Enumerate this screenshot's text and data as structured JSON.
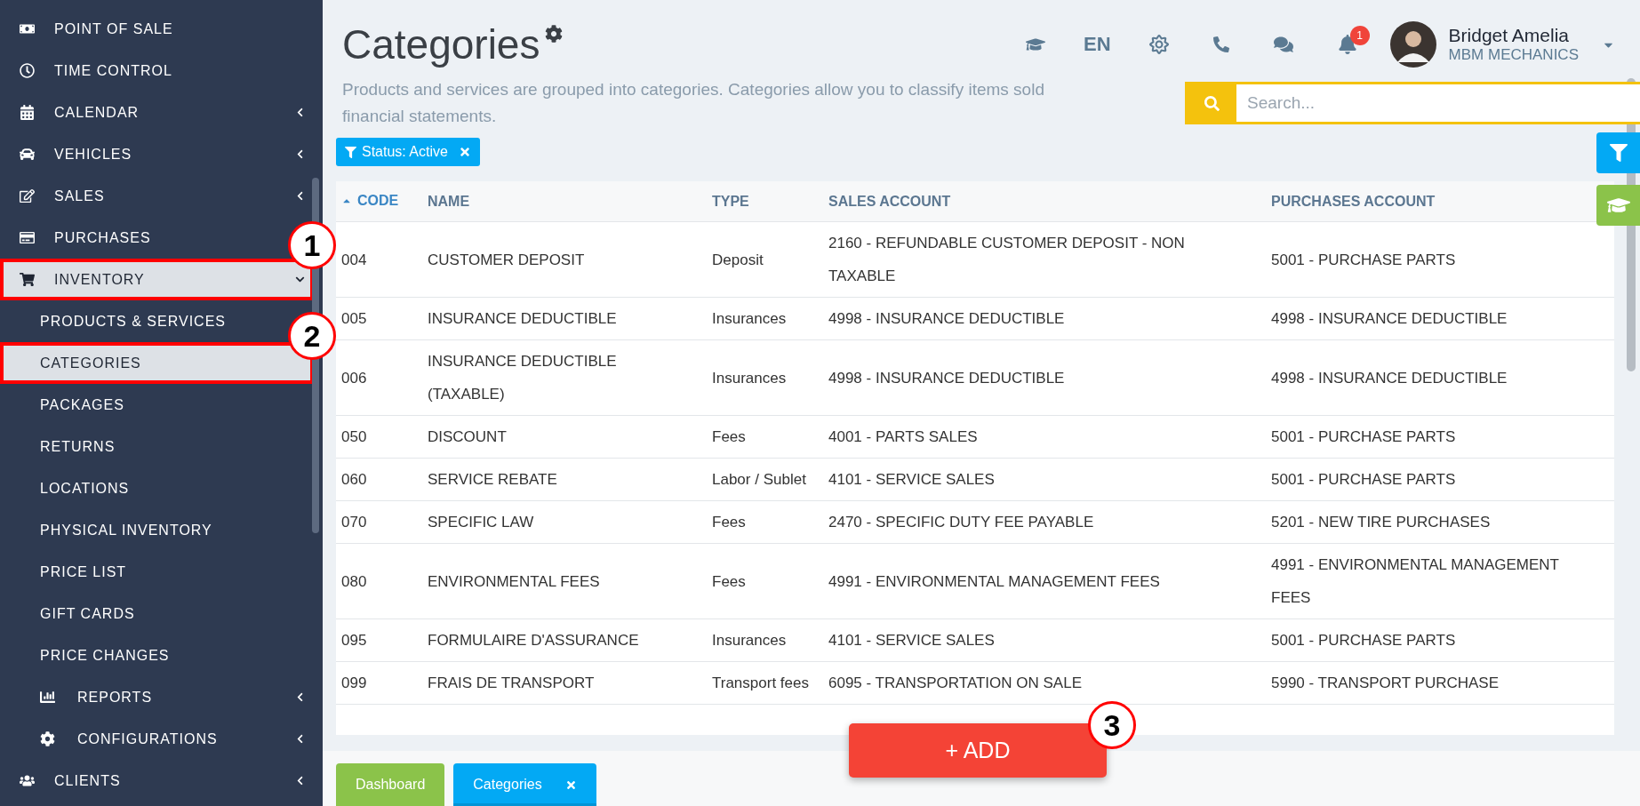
{
  "sidebar": {
    "items": [
      {
        "label": "POINT OF SALE",
        "kind": "link",
        "selected": false
      },
      {
        "label": "TIME CONTROL",
        "kind": "link",
        "selected": false
      },
      {
        "label": "CALENDAR",
        "kind": "group",
        "expanded": false,
        "selected": false
      },
      {
        "label": "VEHICLES",
        "kind": "group",
        "expanded": false,
        "selected": false
      },
      {
        "label": "SALES",
        "kind": "group",
        "expanded": false,
        "selected": false
      },
      {
        "label": "PURCHASES",
        "kind": "link",
        "selected": false
      },
      {
        "label": "INVENTORY",
        "kind": "group",
        "expanded": true,
        "selected": true,
        "annotation": "1",
        "children": [
          {
            "label": "PRODUCTS & SERVICES",
            "kind": "link",
            "selected": false
          },
          {
            "label": "CATEGORIES",
            "kind": "link",
            "selected": true,
            "annotation": "2"
          },
          {
            "label": "PACKAGES",
            "kind": "link",
            "selected": false
          },
          {
            "label": "RETURNS",
            "kind": "link",
            "selected": false
          },
          {
            "label": "LOCATIONS",
            "kind": "link",
            "selected": false
          },
          {
            "label": "PHYSICAL INVENTORY",
            "kind": "link",
            "selected": false
          },
          {
            "label": "PRICE LIST",
            "kind": "link",
            "selected": false
          },
          {
            "label": "GIFT CARDS",
            "kind": "link",
            "selected": false
          },
          {
            "label": "PRICE CHANGES",
            "kind": "link",
            "selected": false
          },
          {
            "label": "REPORTS",
            "kind": "group",
            "expanded": false,
            "selected": false
          },
          {
            "label": "CONFIGURATIONS",
            "kind": "group",
            "expanded": false,
            "selected": false
          }
        ]
      },
      {
        "label": "CLIENTS",
        "kind": "group",
        "expanded": false,
        "selected": false
      }
    ]
  },
  "header": {
    "title": "Categories",
    "description_lines": [
      "Products and services are grouped into categories. Categories allow you to classify items sold",
      "financial statements."
    ],
    "language": "EN",
    "notifications": "1",
    "user": {
      "name": "Bridget Amelia",
      "company": "MBM MECHANICS"
    }
  },
  "search": {
    "placeholder": "Search..."
  },
  "filters": [
    {
      "label": "Status: Active"
    }
  ],
  "table": {
    "columns": [
      {
        "label": "CODE",
        "sorted": true
      },
      {
        "label": "NAME",
        "sorted": false
      },
      {
        "label": "TYPE",
        "sorted": false
      },
      {
        "label": "SALES ACCOUNT",
        "sorted": false
      },
      {
        "label": "PURCHASES ACCOUNT",
        "sorted": false
      }
    ],
    "rows": [
      [
        "004",
        "CUSTOMER DEPOSIT",
        "Deposit",
        "2160 - REFUNDABLE CUSTOMER DEPOSIT - NON TAXABLE",
        "5001 - PURCHASE PARTS"
      ],
      [
        "005",
        "INSURANCE DEDUCTIBLE",
        "Insurances",
        "4998 - INSURANCE DEDUCTIBLE",
        "4998 - INSURANCE DEDUCTIBLE"
      ],
      [
        "006",
        "INSURANCE DEDUCTIBLE (TAXABLE)",
        "Insurances",
        "4998 - INSURANCE DEDUCTIBLE",
        "4998 - INSURANCE DEDUCTIBLE"
      ],
      [
        "050",
        "DISCOUNT",
        "Fees",
        "4001 - PARTS SALES",
        "5001 - PURCHASE PARTS"
      ],
      [
        "060",
        "SERVICE REBATE",
        "Labor / Sublet",
        "4101 - SERVICE SALES",
        "5001 - PURCHASE PARTS"
      ],
      [
        "070",
        "SPECIFIC LAW",
        "Fees",
        "2470 - SPECIFIC DUTY FEE PAYABLE",
        "5201 - NEW TIRE PURCHASES"
      ],
      [
        "080",
        "ENVIRONMENTAL FEES",
        "Fees",
        "4991 - ENVIRONMENTAL MANAGEMENT FEES",
        "4991 - ENVIRONMENTAL MANAGEMENT FEES"
      ],
      [
        "095",
        "FORMULAIRE D'ASSURANCE",
        "Insurances",
        "4101 - SERVICE SALES",
        "5001 - PURCHASE PARTS"
      ],
      [
        "099",
        "FRAIS DE TRANSPORT",
        "Transport fees",
        "6095 - TRANSPORTATION ON SALE",
        "5990 - TRANSPORT PURCHASE"
      ]
    ]
  },
  "add_button": {
    "label": "+ ADD",
    "annotation": "3"
  },
  "bottom_tabs": [
    {
      "label": "Dashboard",
      "kind": "home",
      "selected": false
    },
    {
      "label": "Categories",
      "kind": "page",
      "selected": true
    }
  ]
}
